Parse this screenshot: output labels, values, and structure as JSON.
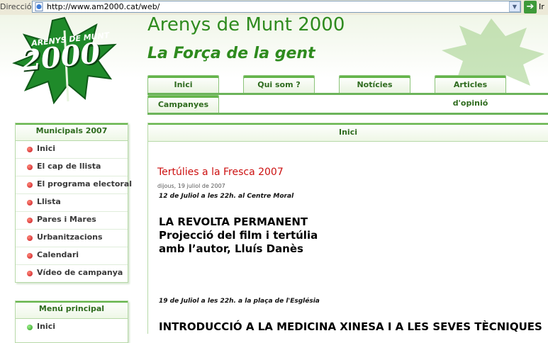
{
  "browser": {
    "address_label": "Dirección",
    "url": "http://www.am2000.cat/web/",
    "go_label": "Ir"
  },
  "header": {
    "logo_text_top": "ARENYS DE MUNT",
    "logo_text_big": "2000",
    "title": "Arenys de Munt 2000",
    "slogan": "La Força de la gent"
  },
  "tabs": [
    {
      "label": "Inici"
    },
    {
      "label": "Qui som ?"
    },
    {
      "label": "Notícies"
    },
    {
      "label": "Articles d'opinió"
    },
    {
      "label": "Campanyes"
    }
  ],
  "sidebar": {
    "municipals": {
      "title": "Municipals 2007",
      "items": [
        {
          "label": "Inici"
        },
        {
          "label": "El cap de llista"
        },
        {
          "label": "El programa electoral"
        },
        {
          "label": "Llista"
        },
        {
          "label": "Pares i Mares"
        },
        {
          "label": "Urbanitzacions"
        },
        {
          "label": "Calendari"
        },
        {
          "label": "Vídeo de campanya"
        }
      ]
    },
    "principal": {
      "title": "Menú principal",
      "items": [
        {
          "label": "Inici"
        }
      ]
    }
  },
  "main": {
    "section_title": "Inici",
    "article": {
      "title": "Tertúlies a la Fresca 2007",
      "date": "dijous, 19 juliol de 2007",
      "event1_when": "12 de Juliol a les 22h. al Centre Moral",
      "event1_lines": [
        "LA REVOLTA PERMANENT",
        "Projecció del film i tertúlia",
        "amb l’autor, Lluís Danès"
      ],
      "event2_when": "19 de Juliol a les 22h. a la plaça de l'Església",
      "event2_line": "INTRODUCCIÓ A LA MEDICINA XINESA I A LES SEVES TÈCNIQUES"
    }
  },
  "colors": {
    "brand_green": "#2e8b1e",
    "accent_red": "#cc1010"
  }
}
